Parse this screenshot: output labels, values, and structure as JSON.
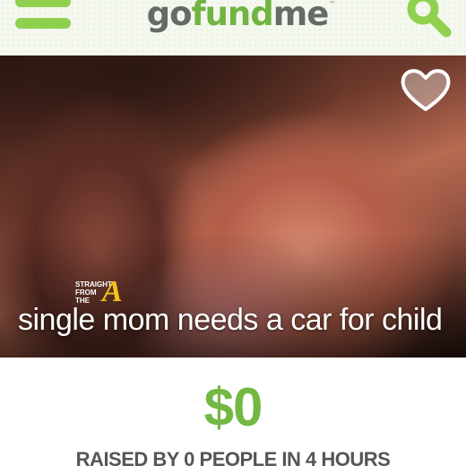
{
  "header": {
    "logo": {
      "part1": "go",
      "part2": "fund",
      "part3": "me",
      "tm": "™"
    },
    "menu_icon": "hamburger-menu-icon",
    "search_icon": "search-icon"
  },
  "campaign": {
    "title": "single mom needs a car for child",
    "favorite_icon": "heart-icon",
    "watermark": {
      "line1": "STRAIGHT",
      "line2": "FROM",
      "line3": "THE",
      "letter": "A"
    }
  },
  "stats": {
    "amount_raised": "$0",
    "raised_text": "RAISED BY 0 PEOPLE IN 4 HOURS"
  },
  "colors": {
    "brand_green": "#74b844",
    "logo_gray": "#666b66",
    "text_gray": "#555555"
  }
}
